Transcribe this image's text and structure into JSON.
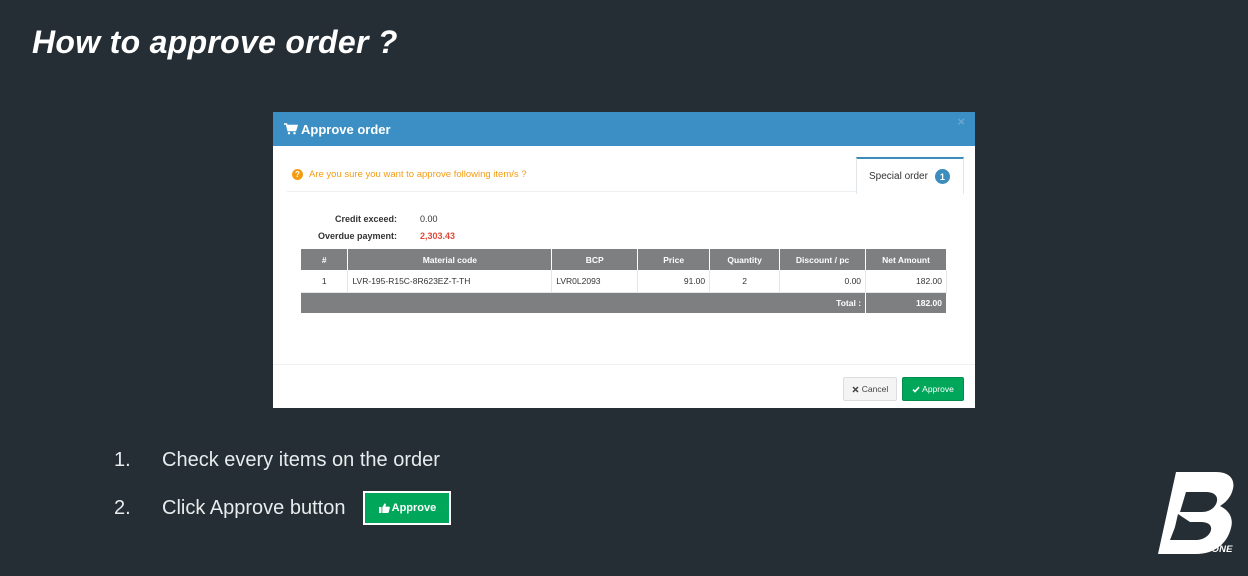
{
  "slide": {
    "title": "How to approve order ?",
    "steps": [
      {
        "num": "1.",
        "text": "Check every items on the order"
      },
      {
        "num": "2.",
        "text": "Click Approve button",
        "button_label": "Approve"
      }
    ],
    "logo_text": "BRIDGESTONE"
  },
  "dialog": {
    "title": "Approve order",
    "close_glyph": "×",
    "confirm_text": "Are you sure you want to approve following item/s ?",
    "tab": {
      "label": "Special order",
      "badge": "1"
    },
    "summary": {
      "credit_label": "Credit exceed:",
      "credit_value": "0.00",
      "overdue_label": "Overdue payment:",
      "overdue_value": "2,303.43"
    },
    "table": {
      "headers": [
        "#",
        "Material code",
        "BCP",
        "Price",
        "Quantity",
        "Discount / pc",
        "Net Amount"
      ],
      "rows": [
        [
          "1",
          "LVR-195-R15C-8R623EZ-T-TH",
          "LVR0L2093",
          "91.00",
          "2",
          "0.00",
          "182.00"
        ]
      ],
      "total_label": "Total :",
      "total_value": "182.00"
    },
    "cancel_label": "Cancel",
    "approve_label": "Approve"
  },
  "colors": {
    "background": "#252e34",
    "header_blue": "#3b8fc5",
    "approve_green": "#00a65a",
    "warning_orange": "#f39c12",
    "overdue_red": "#dd4b39",
    "table_header_gray": "#7d7f81"
  },
  "icons": {
    "dialog_title": "shopping-cart-icon",
    "confirm": "question-circle-icon",
    "cancel": "times-icon",
    "approve": "check-icon",
    "step_approve": "thumbs-up-icon"
  }
}
